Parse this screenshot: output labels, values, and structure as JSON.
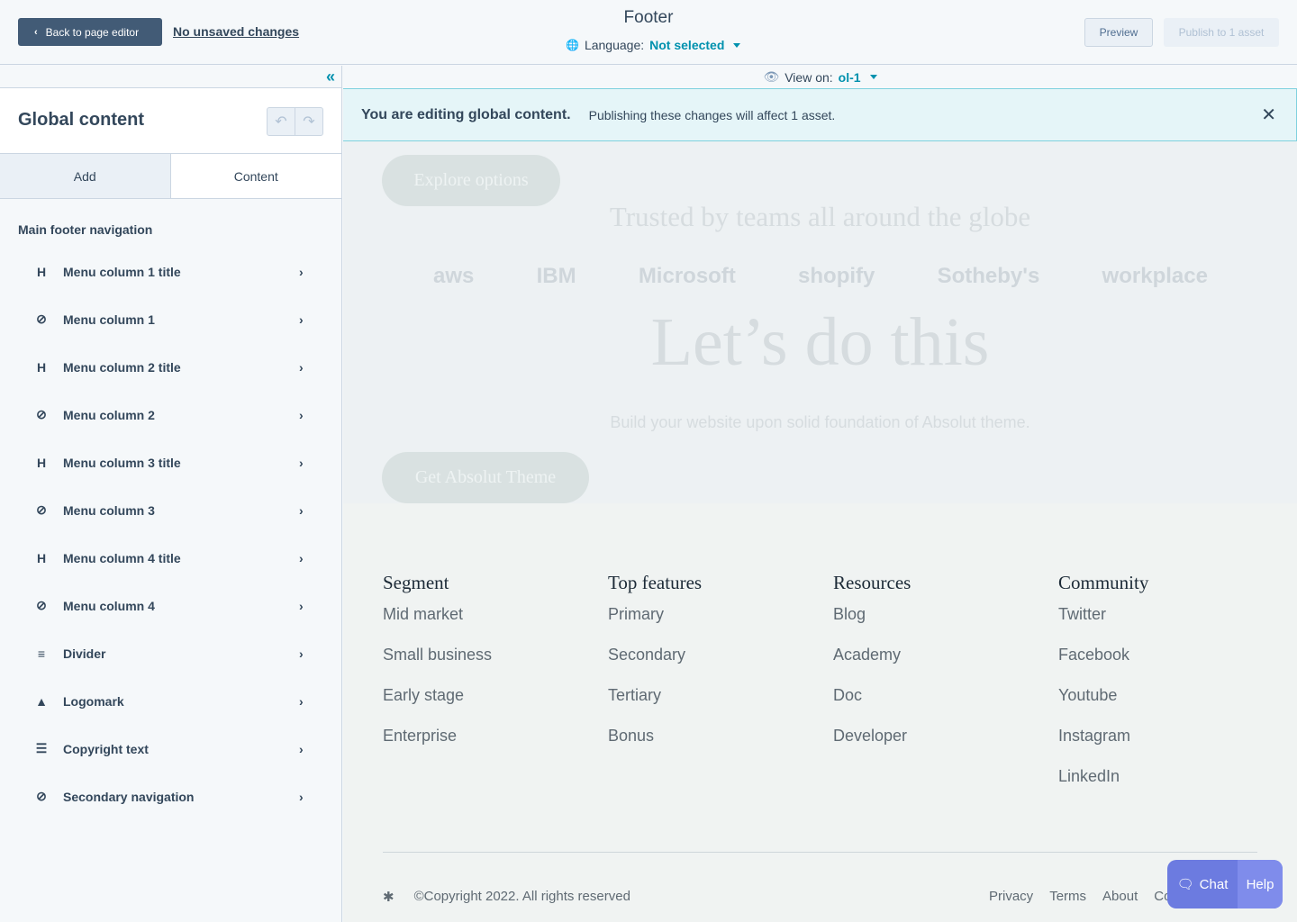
{
  "topbar": {
    "back_label": "Back to page editor",
    "unsaved_label": "No unsaved changes",
    "title": "Footer",
    "language_label": "Language:",
    "language_value": "Not selected",
    "preview_label": "Preview",
    "publish_label": "Publish to 1 asset"
  },
  "sidebar": {
    "title": "Global content",
    "tabs": {
      "add": "Add",
      "content": "Content"
    },
    "section_title": "Main footer navigation",
    "items": [
      {
        "label": "Menu column 1 title",
        "icon": "heading-icon"
      },
      {
        "label": "Menu column 1",
        "icon": "menu-icon"
      },
      {
        "label": "Menu column 2 title",
        "icon": "heading-icon"
      },
      {
        "label": "Menu column 2",
        "icon": "menu-icon"
      },
      {
        "label": "Menu column 3 title",
        "icon": "heading-icon"
      },
      {
        "label": "Menu column 3",
        "icon": "menu-icon"
      },
      {
        "label": "Menu column 4 title",
        "icon": "heading-icon"
      },
      {
        "label": "Menu column 4",
        "icon": "menu-icon"
      },
      {
        "label": "Divider",
        "icon": "divider-icon"
      },
      {
        "label": "Logomark",
        "icon": "logomark-icon"
      },
      {
        "label": "Copyright text",
        "icon": "rich-text-icon"
      },
      {
        "label": "Secondary navigation",
        "icon": "menu-icon"
      }
    ]
  },
  "preview": {
    "view_on_label": "View on:",
    "view_on_value": "ol-1",
    "alert_strong": "You are editing global content.",
    "alert_msg": "Publishing these changes will affect 1 asset.",
    "hero": {
      "explore_btn": "Explore options",
      "trusted": "Trusted by teams all around the globe",
      "logos": [
        "aws",
        "IBM",
        "Microsoft",
        "shopify",
        "Sotheby's",
        "workplace"
      ],
      "headline": "Let’s do this",
      "subline": "Build your website upon solid foundation of Absolut theme.",
      "cta": "Get Absolut Theme"
    },
    "footer": {
      "columns": [
        {
          "title": "Segment",
          "links": [
            "Mid market",
            "Small business",
            "Early stage",
            "Enterprise"
          ]
        },
        {
          "title": "Top features",
          "links": [
            "Primary",
            "Secondary",
            "Tertiary",
            "Bonus"
          ]
        },
        {
          "title": "Resources",
          "links": [
            "Blog",
            "Academy",
            "Doc",
            "Developer"
          ]
        },
        {
          "title": "Community",
          "links": [
            "Twitter",
            "Facebook",
            "Youtube",
            "Instagram",
            "LinkedIn"
          ]
        }
      ],
      "logomark": "✱",
      "copyright": "©Copyright 2022. All rights reserved",
      "secondary_nav": [
        "Privacy",
        "Terms",
        "About",
        "Co"
      ]
    },
    "chat": {
      "chat_label": "Chat",
      "help_label": "Help"
    }
  }
}
